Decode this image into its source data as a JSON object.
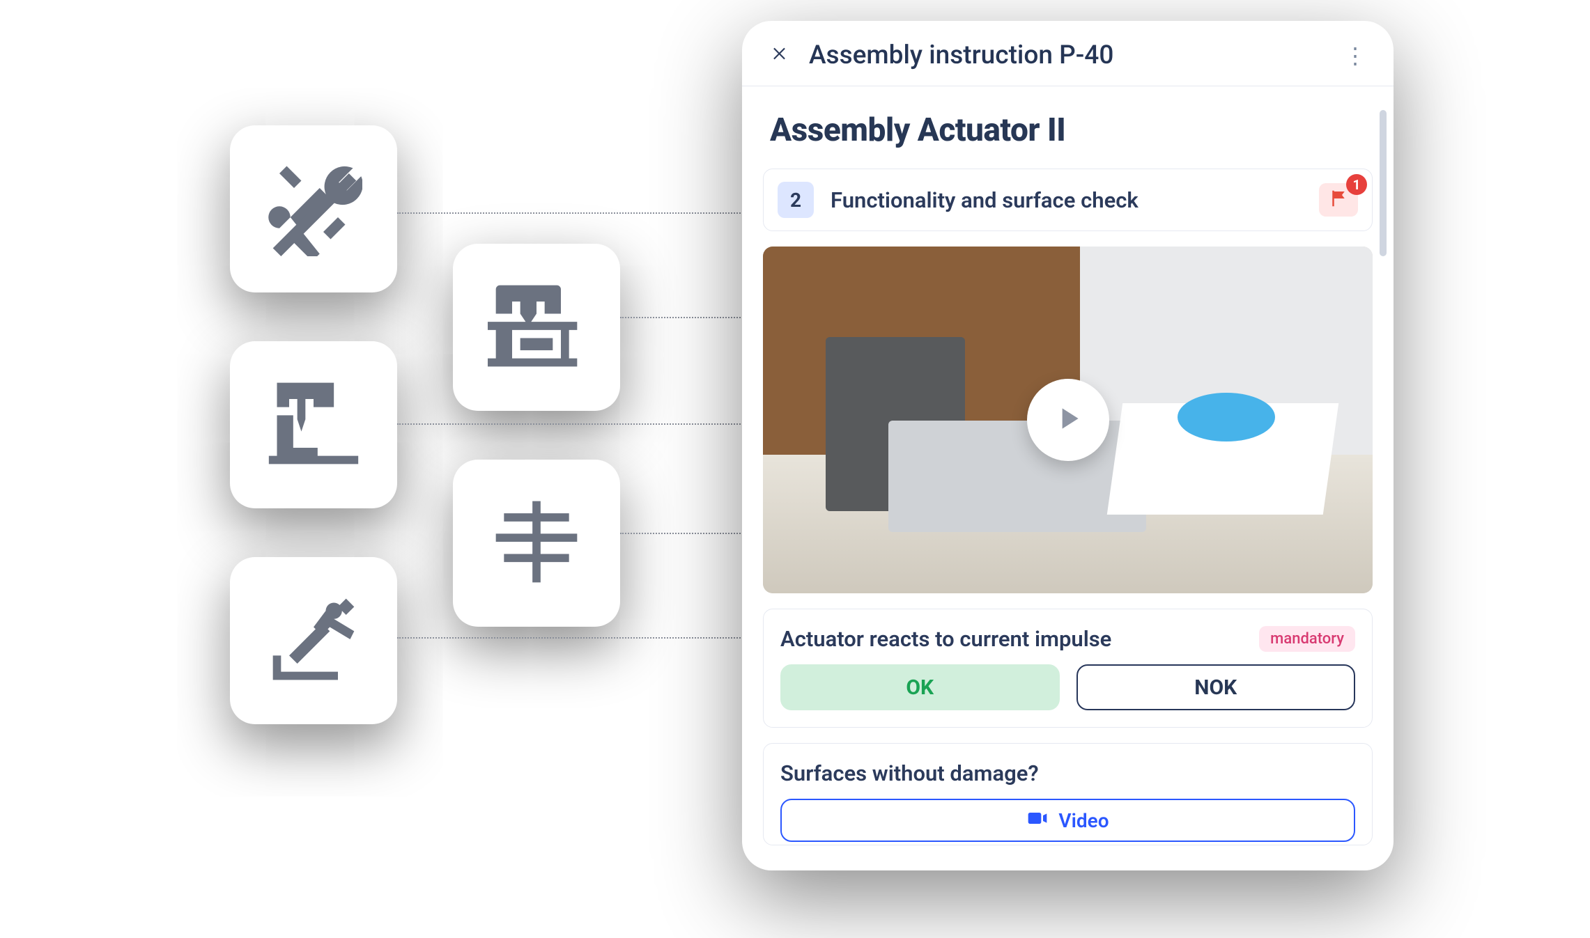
{
  "cluster_icons": [
    {
      "name": "tools-icon"
    },
    {
      "name": "cnc-machine-icon"
    },
    {
      "name": "drill-press-icon"
    },
    {
      "name": "caliper-icon"
    },
    {
      "name": "robot-arm-icon"
    }
  ],
  "header": {
    "title": "Assembly instruction P-40"
  },
  "page_title": "Assembly Actuator II",
  "step": {
    "number": "2",
    "title": "Functionality and surface check",
    "flag_count": "1"
  },
  "question1": {
    "text": "Actuator reacts to current impulse",
    "mandatory_label": "mandatory",
    "ok_label": "OK",
    "nok_label": "NOK"
  },
  "question2": {
    "text": "Surfaces without damage?",
    "video_label": "Video"
  }
}
